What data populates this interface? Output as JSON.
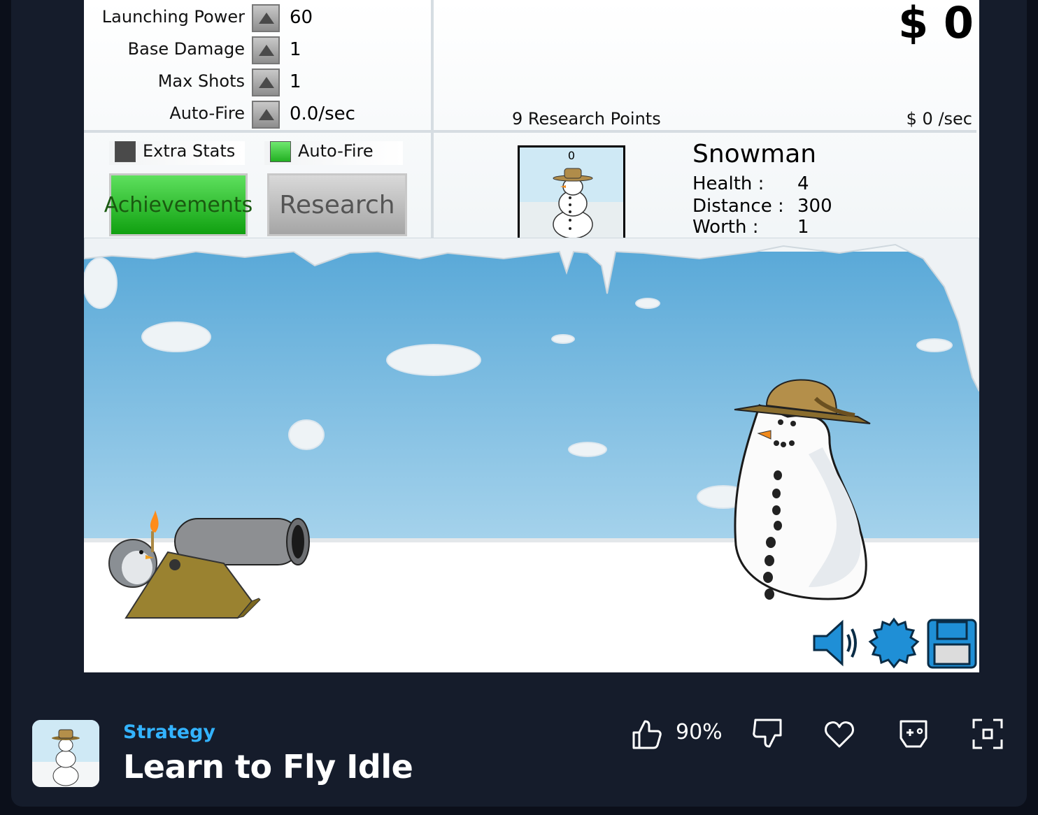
{
  "stats": [
    {
      "label": "Launching Power",
      "value": "60"
    },
    {
      "label": "Base Damage",
      "value": "1"
    },
    {
      "label": "Max Shots",
      "value": "1"
    },
    {
      "label": "Auto-Fire",
      "value": "0.0/sec"
    }
  ],
  "toggles": {
    "extra_stats": "Extra Stats",
    "auto_fire": "Auto-Fire"
  },
  "buttons": {
    "achievements": "Achievements",
    "research": "Research"
  },
  "money": "$ 0",
  "research_points": "9 Research Points",
  "income": "$ 0 /sec",
  "enemy": {
    "count": "0",
    "name": "Snowman",
    "health_label": "Health :",
    "health": "4",
    "distance_label": "Distance :",
    "distance": "300",
    "worth_label": "Worth :",
    "worth": "1"
  },
  "controls": {
    "sound": "speaker-icon",
    "settings": "gear-icon",
    "save": "floppy-disk-icon"
  },
  "footer": {
    "category": "Strategy",
    "title": "Learn to Fly Idle",
    "rating": "90%"
  },
  "colors": {
    "accent": "#33b3ff",
    "background": "#151c2b",
    "achievements": "#2ec02e",
    "controls": "#1f8fd6"
  }
}
